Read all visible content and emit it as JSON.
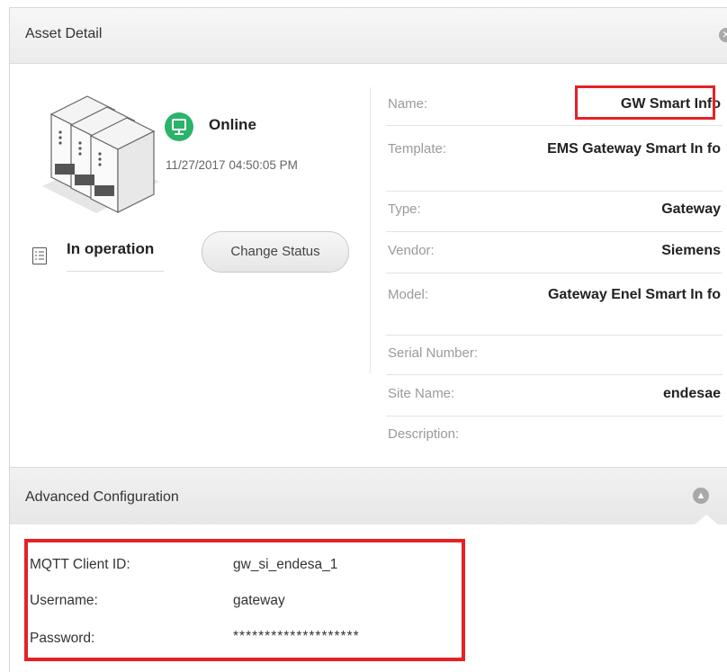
{
  "header": {
    "title": "Asset Detail",
    "close_icon": "close-icon"
  },
  "status": {
    "label": "Online",
    "timestamp": "11/27/2017 04:50:05 PM",
    "icon": "monitor-icon",
    "color": "#2bb36a"
  },
  "operation": {
    "label": "In operation",
    "icon": "checklist-icon",
    "change_button": "Change Status"
  },
  "details": [
    {
      "label": "Name:",
      "value": "GW Smart Info"
    },
    {
      "label": "Template:",
      "value": "EMS Gateway Smart In fo"
    },
    {
      "label": "Type:",
      "value": "Gateway"
    },
    {
      "label": "Vendor:",
      "value": "Siemens"
    },
    {
      "label": "Model:",
      "value": "Gateway Enel Smart In fo"
    },
    {
      "label": "Serial Number:",
      "value": ""
    },
    {
      "label": "Site Name:",
      "value": "endesae"
    },
    {
      "label": "Description:",
      "value": ""
    }
  ],
  "advanced": {
    "title": "Advanced Configuration",
    "toggle_icon": "chevron-up-icon",
    "fields": [
      {
        "label": "MQTT Client ID:",
        "value": "gw_si_endesa_1"
      },
      {
        "label": "Username:",
        "value": "gateway"
      },
      {
        "label": "Password:",
        "value": "********************"
      }
    ]
  },
  "colors": {
    "highlight": "#e32227",
    "status_green": "#2bb36a"
  }
}
